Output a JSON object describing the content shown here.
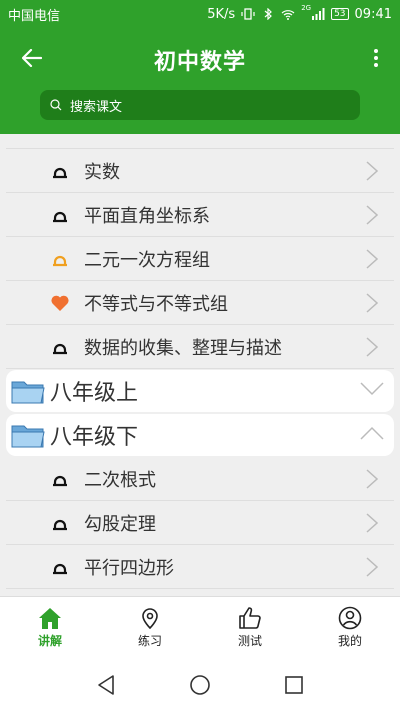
{
  "status_bar": {
    "carrier": "中国电信",
    "speed": "5K/s",
    "network_tag": "2G",
    "battery": "53",
    "time": "09:41"
  },
  "app_bar": {
    "title": "初中数学",
    "back_icon": "arrow-left-icon",
    "more_icon": "more-vertical-icon"
  },
  "search": {
    "placeholder": "搜索课文",
    "icon": "search-icon"
  },
  "sections": [
    {
      "type": "lesson",
      "label": "实数",
      "icon": "scale-icon",
      "color": "#111111"
    },
    {
      "type": "lesson",
      "label": "平面直角坐标系",
      "icon": "scale-icon",
      "color": "#111111"
    },
    {
      "type": "lesson",
      "label": "二元一次方程组",
      "icon": "scale-icon",
      "color": "#f0a020"
    },
    {
      "type": "lesson",
      "label": "不等式与不等式组",
      "icon": "heart-icon",
      "color": "#f07030"
    },
    {
      "type": "lesson",
      "label": "数据的收集、整理与描述",
      "icon": "scale-icon",
      "color": "#111111"
    },
    {
      "type": "grade",
      "label": "八年级上",
      "icon": "folder-icon",
      "expanded": false
    },
    {
      "type": "grade",
      "label": "八年级下",
      "icon": "folder-icon",
      "expanded": true
    },
    {
      "type": "lesson",
      "label": "二次根式",
      "icon": "scale-icon",
      "color": "#111111"
    },
    {
      "type": "lesson",
      "label": "勾股定理",
      "icon": "scale-icon",
      "color": "#111111"
    },
    {
      "type": "lesson",
      "label": "平行四边形",
      "icon": "scale-icon",
      "color": "#111111"
    }
  ],
  "bottom_nav": [
    {
      "label": "讲解",
      "icon": "home-icon",
      "active": true
    },
    {
      "label": "练习",
      "icon": "location-pin-icon",
      "active": false
    },
    {
      "label": "测试",
      "icon": "thumbs-up-icon",
      "active": false
    },
    {
      "label": "我的",
      "icon": "user-icon",
      "active": false
    }
  ],
  "colors": {
    "primary": "#2fa12b",
    "search_bg": "#1f7e1a",
    "background": "#efefef"
  }
}
